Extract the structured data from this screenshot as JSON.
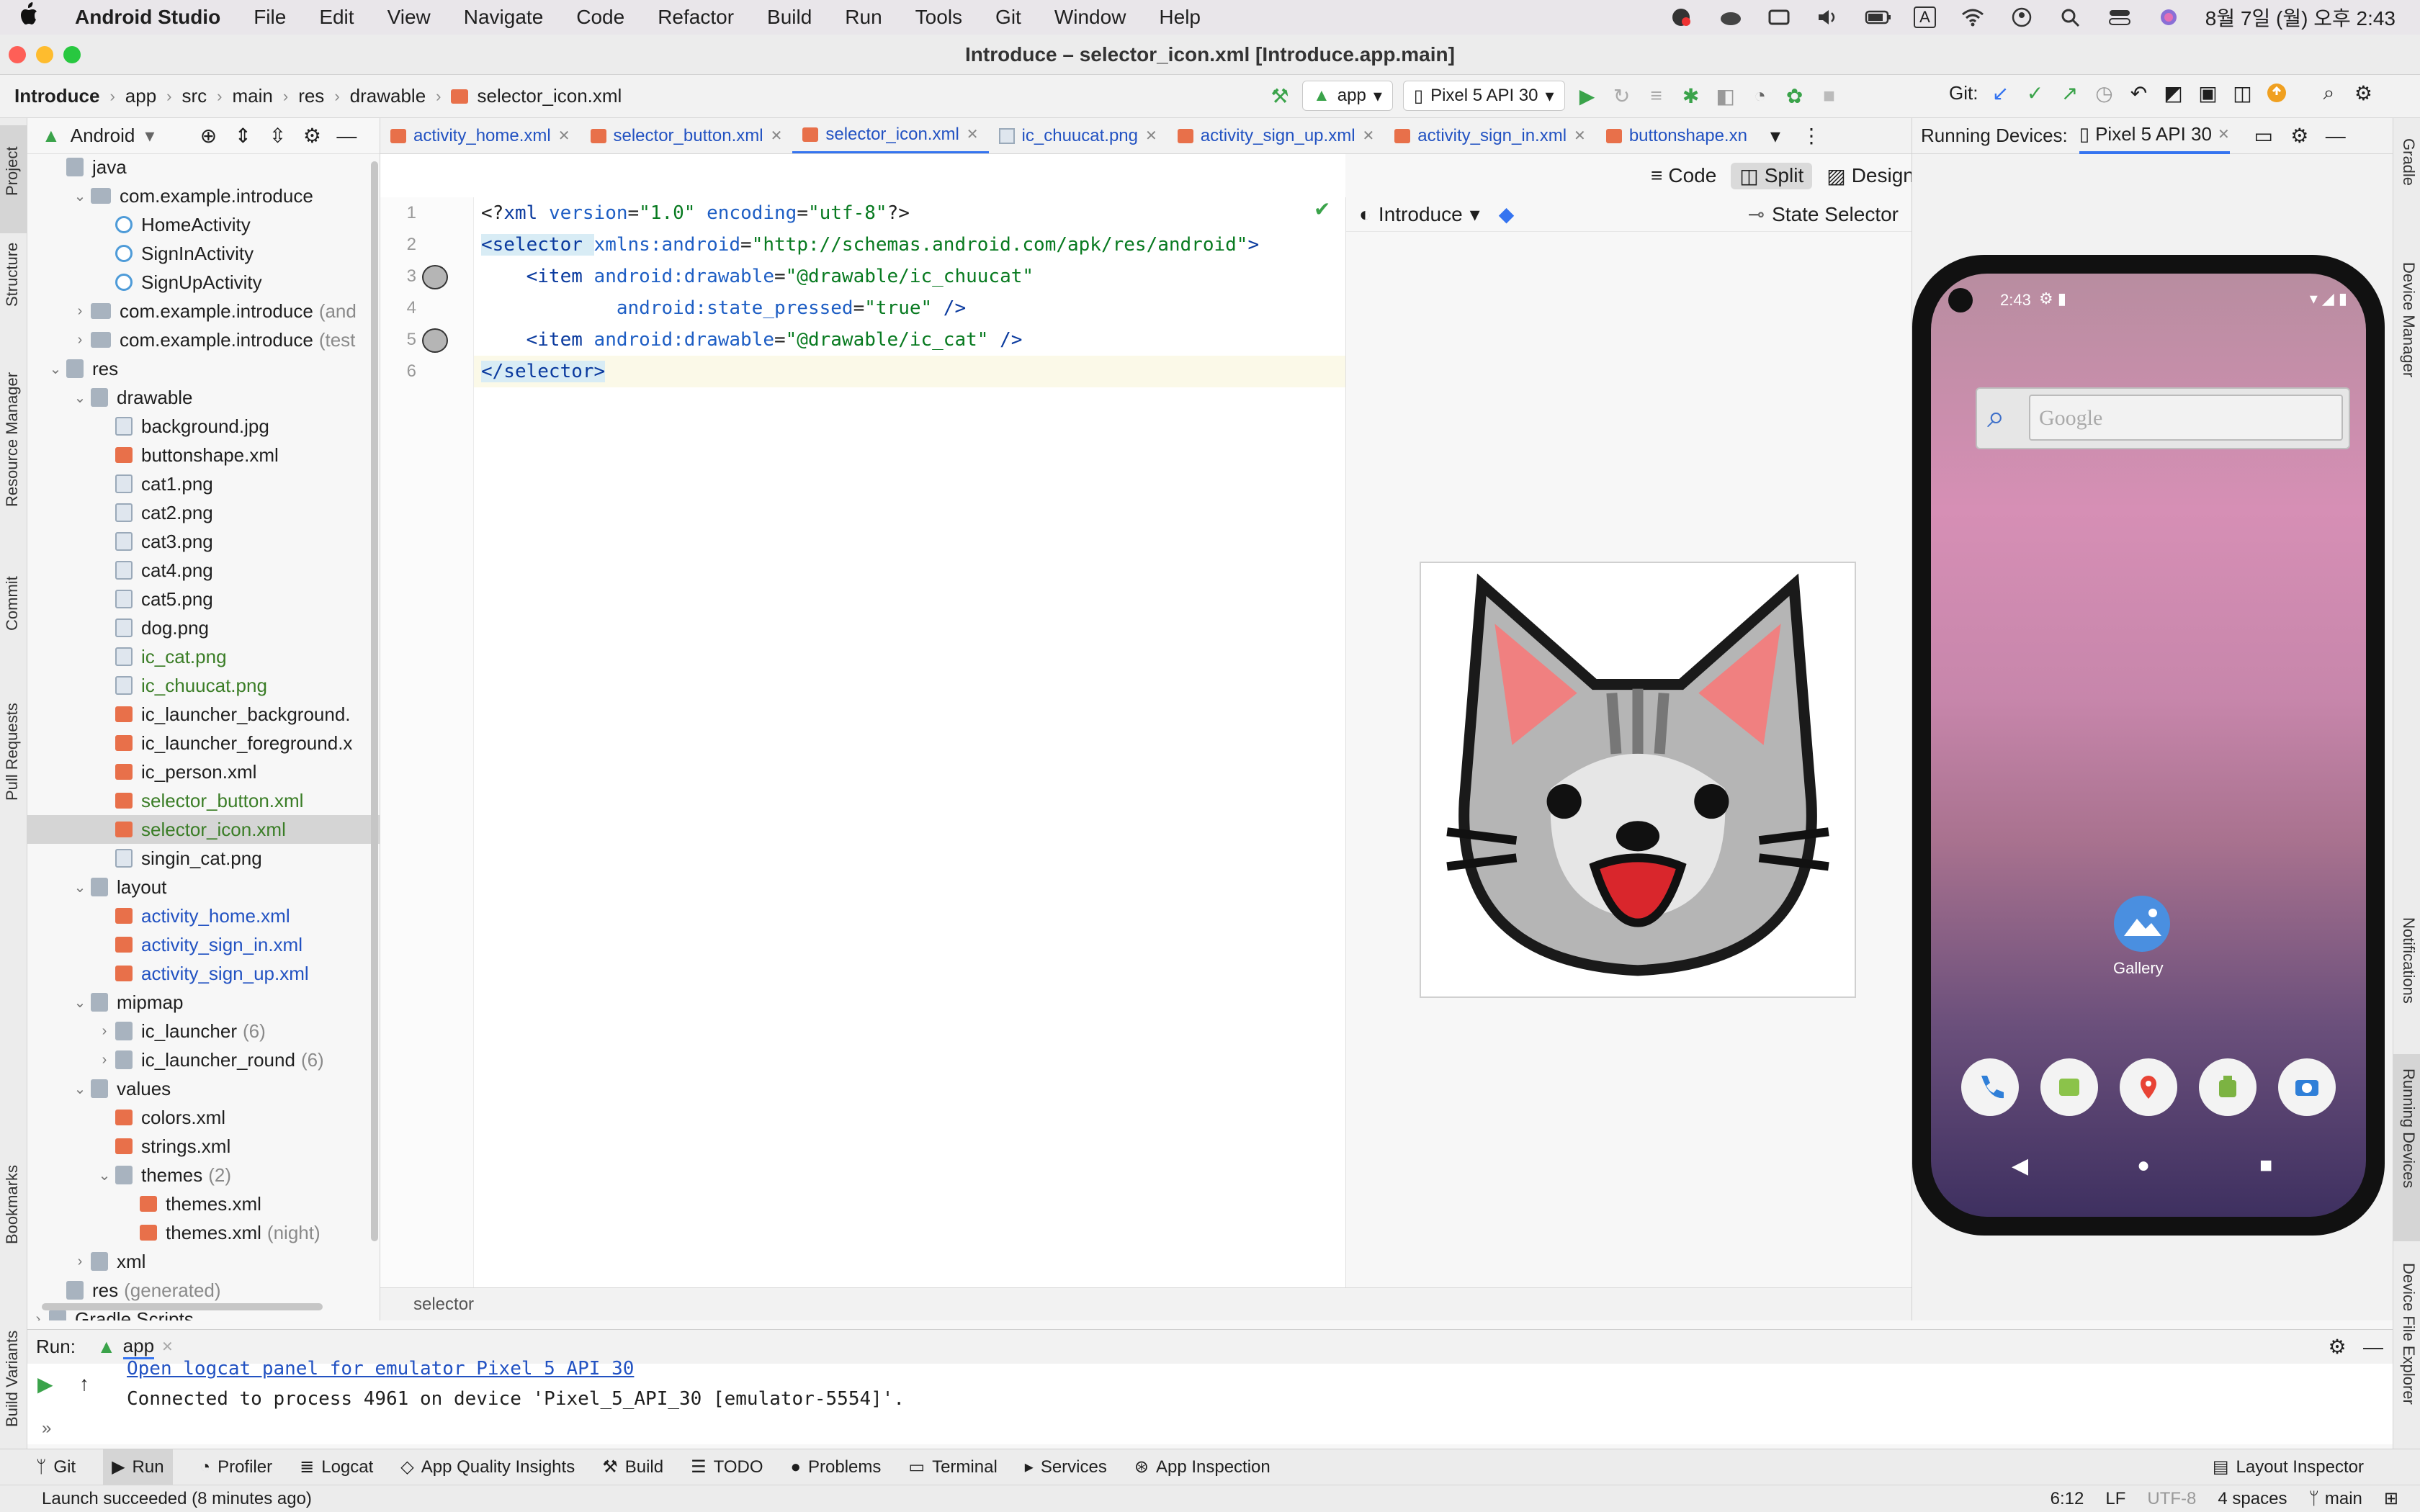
{
  "menubar": {
    "app_name": "Android Studio",
    "items": [
      "File",
      "Edit",
      "View",
      "Navigate",
      "Code",
      "Refactor",
      "Build",
      "Run",
      "Tools",
      "Git",
      "Window",
      "Help"
    ],
    "datetime": "8월 7일 (월) 오후 2:43",
    "input_source": "A"
  },
  "window": {
    "title": "Introduce – selector_icon.xml [Introduce.app.main]"
  },
  "toolbar": {
    "breadcrumb": [
      "Introduce",
      "app",
      "src",
      "main",
      "res",
      "drawable",
      "selector_icon.xml"
    ],
    "run_config": "app",
    "device": "Pixel 5 API 30",
    "git_label": "Git:"
  },
  "project": {
    "view_mode": "Android",
    "tree": [
      {
        "label": "java",
        "indent": 2,
        "type": "folder",
        "cls": ""
      },
      {
        "label": "com.example.introduce",
        "indent": 3,
        "type": "pkg",
        "arrow": "open",
        "cls": ""
      },
      {
        "label": "HomeActivity",
        "indent": 4,
        "type": "class",
        "cls": ""
      },
      {
        "label": "SignInActivity",
        "indent": 4,
        "type": "class",
        "cls": ""
      },
      {
        "label": "SignUpActivity",
        "indent": 4,
        "type": "class",
        "cls": ""
      },
      {
        "label": "com.example.introduce",
        "suffix": "(and",
        "indent": 3,
        "type": "pkg",
        "arrow": "closed",
        "cls": ""
      },
      {
        "label": "com.example.introduce",
        "suffix": "(test",
        "indent": 3,
        "type": "pkg",
        "arrow": "closed",
        "cls": ""
      },
      {
        "label": "res",
        "indent": 2,
        "type": "folder",
        "arrow": "open",
        "cls": ""
      },
      {
        "label": "drawable",
        "indent": 3,
        "type": "folder",
        "arrow": "open",
        "cls": ""
      },
      {
        "label": "background.jpg",
        "indent": 4,
        "type": "img",
        "cls": ""
      },
      {
        "label": "buttonshape.xml",
        "indent": 4,
        "type": "xml",
        "cls": ""
      },
      {
        "label": "cat1.png",
        "indent": 4,
        "type": "img",
        "cls": ""
      },
      {
        "label": "cat2.png",
        "indent": 4,
        "type": "img",
        "cls": ""
      },
      {
        "label": "cat3.png",
        "indent": 4,
        "type": "img",
        "cls": ""
      },
      {
        "label": "cat4.png",
        "indent": 4,
        "type": "img",
        "cls": ""
      },
      {
        "label": "cat5.png",
        "indent": 4,
        "type": "img",
        "cls": ""
      },
      {
        "label": "dog.png",
        "indent": 4,
        "type": "img",
        "cls": ""
      },
      {
        "label": "ic_cat.png",
        "indent": 4,
        "type": "img",
        "cls": "green"
      },
      {
        "label": "ic_chuucat.png",
        "indent": 4,
        "type": "img",
        "cls": "green"
      },
      {
        "label": "ic_launcher_background.",
        "indent": 4,
        "type": "xml",
        "cls": ""
      },
      {
        "label": "ic_launcher_foreground.x",
        "indent": 4,
        "type": "xml",
        "cls": ""
      },
      {
        "label": "ic_person.xml",
        "indent": 4,
        "type": "xml",
        "cls": ""
      },
      {
        "label": "selector_button.xml",
        "indent": 4,
        "type": "xml",
        "cls": "green"
      },
      {
        "label": "selector_icon.xml",
        "indent": 4,
        "type": "xml",
        "cls": "green",
        "selected": true
      },
      {
        "label": "singin_cat.png",
        "indent": 4,
        "type": "img",
        "cls": ""
      },
      {
        "label": "layout",
        "indent": 3,
        "type": "folder",
        "arrow": "open",
        "cls": ""
      },
      {
        "label": "activity_home.xml",
        "indent": 4,
        "type": "xml",
        "cls": "blue"
      },
      {
        "label": "activity_sign_in.xml",
        "indent": 4,
        "type": "xml",
        "cls": "blue"
      },
      {
        "label": "activity_sign_up.xml",
        "indent": 4,
        "type": "xml",
        "cls": "blue"
      },
      {
        "label": "mipmap",
        "indent": 3,
        "type": "folder",
        "arrow": "open",
        "cls": ""
      },
      {
        "label": "ic_launcher",
        "suffix": "(6)",
        "indent": 4,
        "type": "folder",
        "arrow": "closed",
        "cls": ""
      },
      {
        "label": "ic_launcher_round",
        "suffix": "(6)",
        "indent": 4,
        "type": "folder",
        "arrow": "closed",
        "cls": ""
      },
      {
        "label": "values",
        "indent": 3,
        "type": "folder",
        "arrow": "open",
        "cls": ""
      },
      {
        "label": "colors.xml",
        "indent": 4,
        "type": "xml",
        "cls": ""
      },
      {
        "label": "strings.xml",
        "indent": 4,
        "type": "xml",
        "cls": ""
      },
      {
        "label": "themes",
        "suffix": "(2)",
        "indent": 4,
        "type": "folder",
        "arrow": "open",
        "cls": ""
      },
      {
        "label": "themes.xml",
        "indent": 5,
        "type": "xml",
        "cls": ""
      },
      {
        "label": "themes.xml",
        "suffix": "(night)",
        "indent": 5,
        "type": "xml",
        "cls": ""
      },
      {
        "label": "xml",
        "indent": 3,
        "type": "folder",
        "arrow": "closed",
        "cls": ""
      },
      {
        "label": "res",
        "suffix": "(generated)",
        "indent": 2,
        "type": "folder",
        "cls": ""
      },
      {
        "label": "Gradle Scripts",
        "indent": 1,
        "type": "folder",
        "arrow": "closed",
        "cls": ""
      }
    ]
  },
  "tabs": [
    {
      "label": "activity_home.xml",
      "kind": "xml"
    },
    {
      "label": "selector_button.xml",
      "kind": "xml"
    },
    {
      "label": "selector_icon.xml",
      "kind": "xml",
      "active": true
    },
    {
      "label": "ic_chuucat.png",
      "kind": "png"
    },
    {
      "label": "activity_sign_up.xml",
      "kind": "xml"
    },
    {
      "label": "activity_sign_in.xml",
      "kind": "xml"
    },
    {
      "label": "buttonshape.xn",
      "kind": "xml"
    }
  ],
  "editor": {
    "view_modes": [
      "Code",
      "Split",
      "Design"
    ],
    "active_mode": "Split",
    "lines": [
      {
        "num": "1",
        "parts": [
          [
            "pi",
            "<?"
          ],
          [
            "tagc",
            "xml "
          ],
          [
            "attrc",
            "version"
          ],
          [
            "pi",
            "="
          ],
          [
            "valc",
            "\"1.0\""
          ],
          [
            "pi",
            " "
          ],
          [
            "attrc",
            "encoding"
          ],
          [
            "pi",
            "="
          ],
          [
            "valc",
            "\"utf-8\""
          ],
          [
            "pi",
            "?>"
          ]
        ]
      },
      {
        "num": "2",
        "parts": [
          [
            "tagc",
            "<selector "
          ],
          [
            "attrc",
            "xmlns:android"
          ],
          [
            "pi",
            "="
          ],
          [
            "valc",
            "\"http://schemas.android.com/apk/res/android\""
          ],
          [
            "tagc",
            ">"
          ]
        ]
      },
      {
        "num": "3",
        "parts": [
          [
            "pi",
            "    "
          ],
          [
            "tagc",
            "<item "
          ],
          [
            "attrc",
            "android:drawable"
          ],
          [
            "pi",
            "="
          ],
          [
            "valc",
            "\"@drawable/ic_chuucat\""
          ]
        ]
      },
      {
        "num": "4",
        "parts": [
          [
            "pi",
            "            "
          ],
          [
            "attrc",
            "android:state_pressed"
          ],
          [
            "pi",
            "="
          ],
          [
            "valc",
            "\"true\""
          ],
          [
            "tagc",
            " />"
          ]
        ]
      },
      {
        "num": "5",
        "parts": [
          [
            "pi",
            "    "
          ],
          [
            "tagc",
            "<item "
          ],
          [
            "attrc",
            "android:drawable"
          ],
          [
            "pi",
            "="
          ],
          [
            "valc",
            "\"@drawable/ic_cat\""
          ],
          [
            "tagc",
            " />"
          ]
        ]
      },
      {
        "num": "6",
        "parts": [
          [
            "tagc",
            "</selector>"
          ]
        ]
      }
    ],
    "breadcrumb_status": "selector"
  },
  "preview": {
    "theme": "Introduce",
    "state_selector": "State Selector"
  },
  "devices": {
    "title": "Running Devices:",
    "device_tab": "Pixel 5 API 30",
    "phone_time": "2:43",
    "search_placeholder": "Google",
    "gallery_label": "Gallery"
  },
  "run": {
    "label": "Run:",
    "config": "app",
    "link_text": "Open logcat panel for emulator Pixel 5 API 30",
    "message": "Connected to process 4961 on device 'Pixel_5_API_30 [emulator-5554]'."
  },
  "bottom_tools": [
    "Git",
    "Run",
    "Profiler",
    "Logcat",
    "App Quality Insights",
    "Build",
    "TODO",
    "Problems",
    "Terminal",
    "Services",
    "App Inspection"
  ],
  "bottom_right_tool": "Layout Inspector",
  "statusbar": {
    "message": "Launch succeeded (8 minutes ago)",
    "position": "6:12",
    "line_sep": "LF",
    "encoding": "UTF-8",
    "indent": "4 spaces",
    "branch": "main"
  },
  "left_tools": [
    "Project",
    "Structure",
    "Resource Manager",
    "Commit",
    "Pull Requests",
    "Bookmarks",
    "Build Variants"
  ],
  "right_tools": [
    "Gradle",
    "Device Manager",
    "Notifications",
    "Running Devices",
    "Device File Explorer"
  ],
  "colors": {
    "accent": "#3574f0",
    "run_green": "#3aa34a",
    "cat_gray": "#b5b5b5",
    "mouth_red": "#d9262c",
    "ear_pink": "#f08080"
  }
}
